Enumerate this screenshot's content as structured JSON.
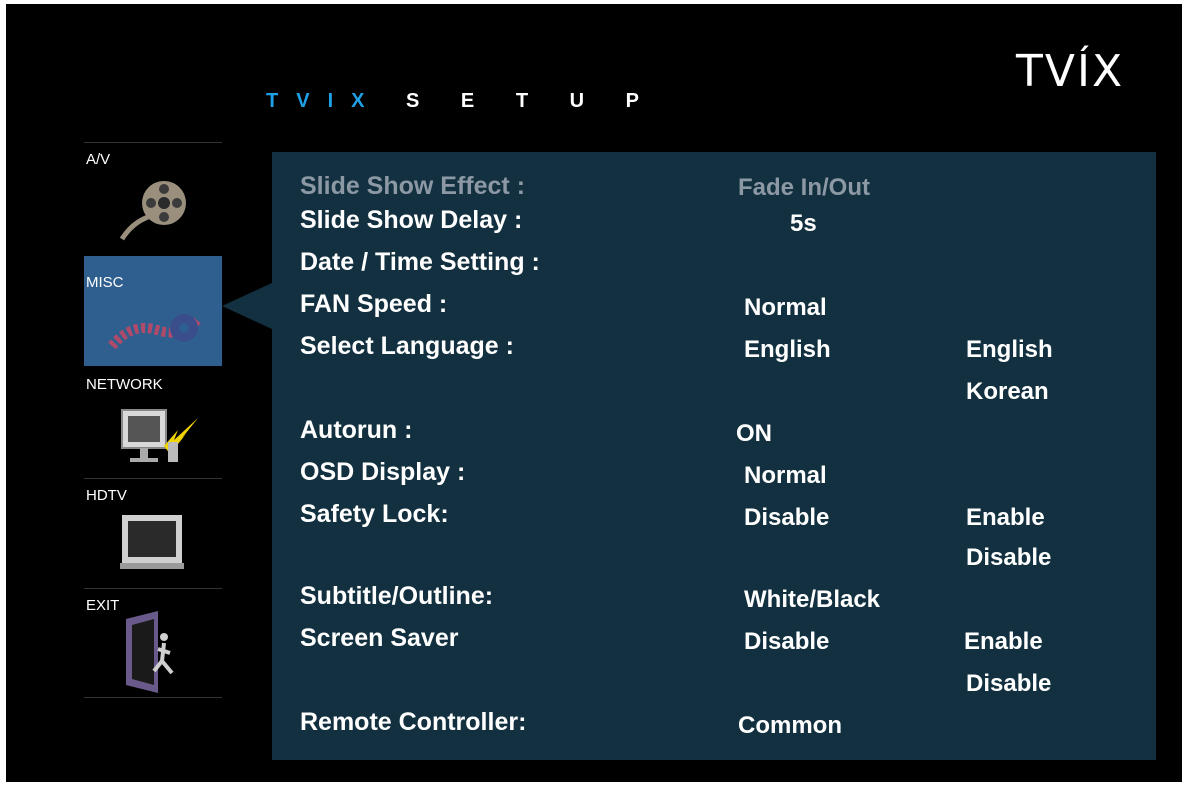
{
  "brand": {
    "logo": "TVÍX"
  },
  "title": {
    "tvix": "T V I X",
    "t": "T",
    "v": "V",
    "i": "I",
    "x": "X",
    "setup": "S E T U P"
  },
  "sidebar": {
    "items": [
      {
        "label": "A/V"
      },
      {
        "label": "MISC"
      },
      {
        "label": "NETWORK"
      },
      {
        "label": "HDTV"
      },
      {
        "label": "EXIT"
      }
    ],
    "selected": "MISC"
  },
  "settings": [
    {
      "label": "Slide Show Effect :",
      "value": "Fade In/Out"
    },
    {
      "label": "Slide Show Delay :",
      "value": "5s"
    },
    {
      "label": "Date / Time Setting :",
      "value": ""
    },
    {
      "label": "FAN Speed :",
      "value": "Normal"
    },
    {
      "label": "Select Language :",
      "value": "English",
      "options": [
        "English",
        "Korean"
      ]
    },
    {
      "label": "Autorun :",
      "value": "ON"
    },
    {
      "label": "OSD Display :",
      "value": "Normal"
    },
    {
      "label": "Safety Lock:",
      "value": "Disable",
      "options": [
        "Enable",
        "Disable"
      ]
    },
    {
      "label": "Subtitle/Outline:",
      "value": "White/Black"
    },
    {
      "label": "Screen Saver",
      "value": "Disable",
      "options": [
        "Enable",
        "Disable"
      ]
    },
    {
      "label": "Remote Controller:",
      "value": "Common"
    }
  ],
  "colors": {
    "accent": "#1e9fe6",
    "panel": "#12303f",
    "selected": "#2f5f8e",
    "dim": "#8c98a4"
  }
}
